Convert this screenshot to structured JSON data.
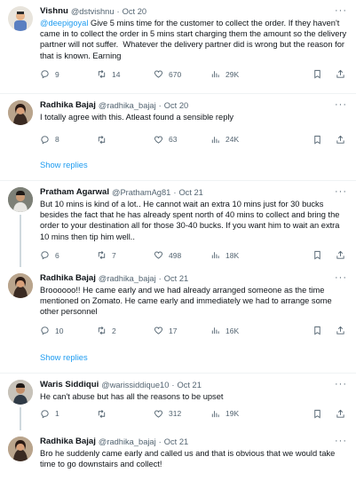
{
  "tweets": [
    {
      "name": "Vishnu",
      "handle": "@dstvishnu",
      "time": "Oct 20",
      "mention": "@deepigoyal",
      "text": " Give 5 mins time for the customer to collect the order. If they haven't came in to collect the order in 5 mins start charging them the amount so the delivery partner will not suffer.  Whatever the delivery partner did is wrong but the reason for that is known. Earning",
      "replies": "9",
      "retweets": "14",
      "likes": "670",
      "views": "29K"
    },
    {
      "name": "Radhika Bajaj",
      "handle": "@radhika_bajaj",
      "time": "Oct 20",
      "text": "I totally agree with this. Atleast found a sensible reply",
      "replies": "8",
      "retweets": "",
      "likes": "63",
      "views": "24K"
    },
    {
      "name": "Pratham Agarwal",
      "handle": "@PrathamAg81",
      "time": "Oct 21",
      "text": "But 10 mins is kind of a lot.. He cannot wait an extra 10 mins just for 30 bucks besides the fact that he has already spent north of 40 mins to collect and bring the order to your destination all for those 30-40 bucks. If you want him to wait an extra 10 mins then tip him well..",
      "replies": "6",
      "retweets": "7",
      "likes": "498",
      "views": "18K"
    },
    {
      "name": "Radhika Bajaj",
      "handle": "@radhika_bajaj",
      "time": "Oct 21",
      "text": "Broooooo!! He came early and we had already arranged someone as the time mentioned on Zomato. He came early and immediately we had to arrange some other personnel",
      "replies": "10",
      "retweets": "2",
      "likes": "17",
      "views": "16K"
    },
    {
      "name": "Waris Siddiqui",
      "handle": "@warissiddique10",
      "time": "Oct 21",
      "text": "He can't abuse but has all the reasons to be upset",
      "replies": "1",
      "retweets": "",
      "likes": "312",
      "views": "19K"
    },
    {
      "name": "Radhika Bajaj",
      "handle": "@radhika_bajaj",
      "time": "Oct 21",
      "text": "Bro he suddenly came early and called us and that is obvious that we would take time to go downstairs and collect!"
    }
  ],
  "show_replies_label": "Show replies",
  "dot": "·",
  "more": "···",
  "colors": {
    "link": "#1d9bf0",
    "muted": "#536471",
    "thread": "#cfd9de"
  }
}
